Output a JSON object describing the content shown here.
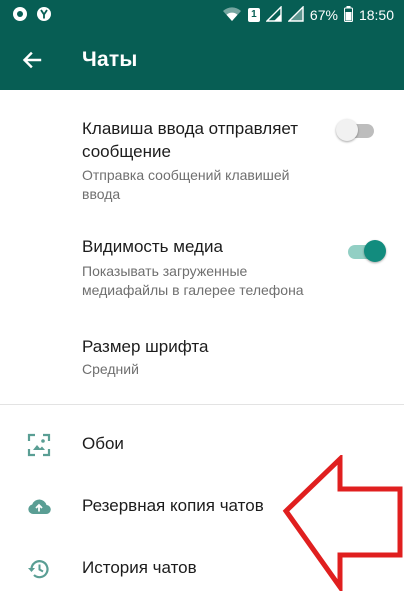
{
  "status_bar": {
    "battery": "67%",
    "time": "18:50",
    "sim_badge": "1"
  },
  "app_bar": {
    "title": "Чаты"
  },
  "settings": {
    "enter_key": {
      "title_line1": "Клавиша ввода отправляет",
      "title_line2": "сообщение",
      "summary_line1": "Отправка сообщений клавишей",
      "summary_line2": "ввода",
      "enabled": false
    },
    "media_visibility": {
      "title": "Видимость медиа",
      "summary_line1": "Показывать загруженные",
      "summary_line2": "медиафайлы в галерее телефона",
      "enabled": true
    },
    "font_size": {
      "title": "Размер шрифта",
      "value": "Средний"
    }
  },
  "nav": {
    "wallpaper": {
      "label": "Обои",
      "icon": "wallpaper-icon"
    },
    "backup": {
      "label": "Резервная копия чатов",
      "icon": "cloud-upload-icon"
    },
    "history": {
      "label": "История чатов",
      "icon": "history-icon"
    }
  },
  "colors": {
    "primary_dark": "#075e54",
    "accent": "#128c7e",
    "icon_teal": "#5a9e94",
    "annotation_red": "#e01f1f"
  }
}
